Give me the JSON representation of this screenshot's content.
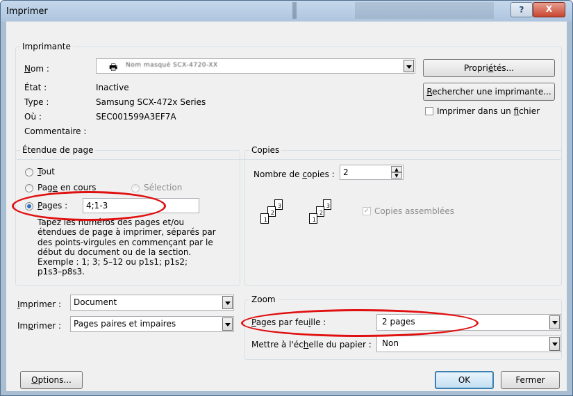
{
  "window": {
    "title": "Imprimer",
    "help": "?",
    "close": "X"
  },
  "printer": {
    "legend": "Imprimante",
    "name_label": "Nom :",
    "name_value": "Nom masqué SCX-4720-XX",
    "etat_label": "État :",
    "etat_value": "Inactive",
    "type_label": "Type :",
    "type_value": "Samsung SCX-472x Series",
    "ou_label": "Où :",
    "ou_value": "SEC001599A3EF7A",
    "comment_label": "Commentaire :",
    "properties_btn": "Propriétés...",
    "find_btn": "Rechercher une imprimante...",
    "print_to_file": "Imprimer dans un fichier"
  },
  "range": {
    "legend": "Étendue de page",
    "all": "Tout",
    "current": "Page en cours",
    "selection": "Sélection",
    "pages_label": "Pages :",
    "pages_value": "4;1-3",
    "help_lines": [
      "Tapez les numéros des pages et/ou",
      "étendues de page à imprimer, séparés par",
      "des points-virgules en commençant par le",
      "début du document ou de la section.",
      "Exemple : 1; 3; 5–12 ou p1s1; p1s2;",
      "p1s3–p8s3."
    ]
  },
  "copies": {
    "legend": "Copies",
    "count_label": "Nombre de copies :",
    "count_value": "2",
    "collate": "Copies assemblées",
    "page_numbers": [
      "3",
      "2",
      "1"
    ]
  },
  "print_what": {
    "label": "Imprimer :",
    "value": "Document"
  },
  "print_which": {
    "label": "Imprimer :",
    "value": "Pages paires et impaires"
  },
  "zoom": {
    "legend": "Zoom",
    "pps_label": "Pages par feuille :",
    "pps_value": "2 pages",
    "scale_label": "Mettre à l'échelle du papier :",
    "scale_value": "Non"
  },
  "buttons": {
    "options": "Options...",
    "ok": "OK",
    "cancel": "Fermer"
  },
  "colors": {
    "highlight": "#e01010",
    "radio_selected": "#2a6fc2"
  }
}
